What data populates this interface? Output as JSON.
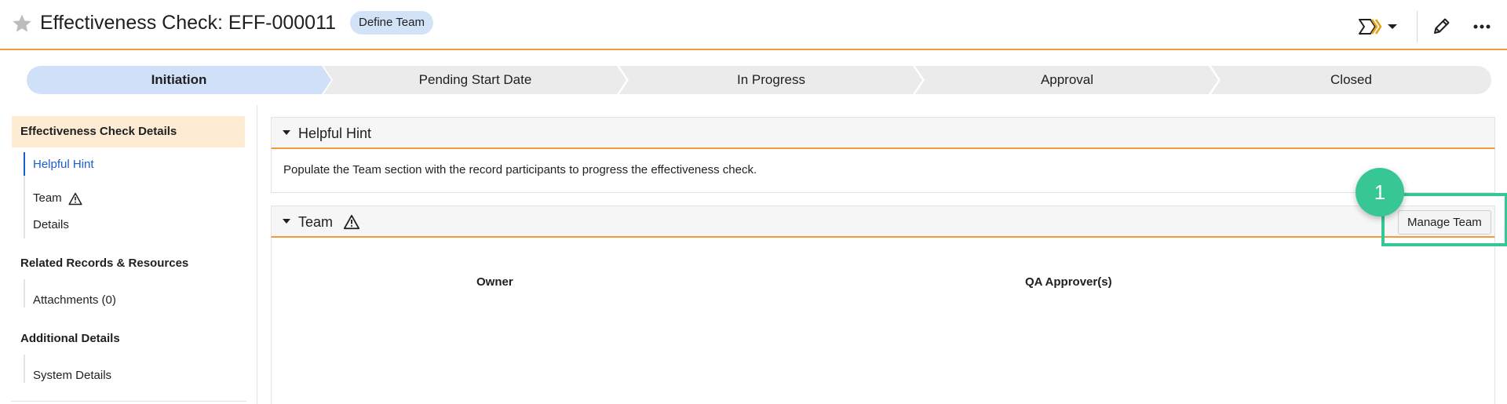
{
  "header": {
    "title": "Effectiveness Check: EFF-000011",
    "badge": "Define Team",
    "icons": [
      "star-icon",
      "workflow-icon",
      "chevron-down-icon",
      "edit-pencil-icon",
      "more-options-icon"
    ]
  },
  "stepper": {
    "steps": [
      {
        "label": "Initiation",
        "active": true
      },
      {
        "label": "Pending Start Date",
        "active": false
      },
      {
        "label": "In Progress",
        "active": false
      },
      {
        "label": "Approval",
        "active": false
      },
      {
        "label": "Closed",
        "active": false
      }
    ]
  },
  "sidebar": {
    "sections": [
      {
        "title": "Effectiveness Check Details",
        "items": [
          "Helpful Hint",
          "Team",
          "Details"
        ]
      },
      {
        "title": "Related Records & Resources",
        "items": [
          "Attachments (0)"
        ]
      },
      {
        "title": "Additional Details",
        "items": [
          "System Details"
        ]
      }
    ],
    "selected_item": "Helpful Hint"
  },
  "main": {
    "hint_panel": {
      "title": "Helpful Hint",
      "text": "Populate the Team section with the record participants to progress the effectiveness check."
    },
    "team_panel": {
      "title": "Team",
      "manage_button": "Manage Team",
      "columns": [
        "Owner",
        "QA Approver(s)"
      ]
    }
  },
  "annotation": {
    "marker_number": "1"
  },
  "colors": {
    "accent_orange": "#f29a3c",
    "active_step": "#cfe0f8",
    "inactive_step": "#ebebeb",
    "active_section_bg": "#fdebd3",
    "link_blue": "#1a5ec9",
    "annotation_green": "#37c795",
    "badge_bg": "#d3e3f7"
  }
}
